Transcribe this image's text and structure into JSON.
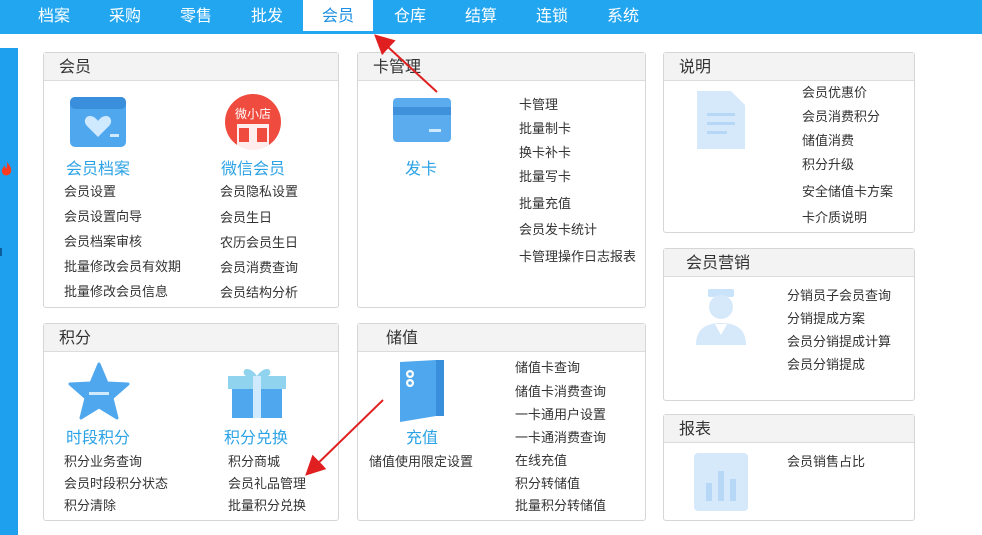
{
  "nav": [
    "档案",
    "采购",
    "零售",
    "批发",
    "会员",
    "仓库",
    "结算",
    "连锁",
    "系统"
  ],
  "active_nav": "会员",
  "member": {
    "title": "会员",
    "archive_label": "会员档案",
    "wechat_label": "微信会员",
    "wechat_badge": "微小店",
    "left_links": [
      "会员设置",
      "会员设置向导",
      "会员档案审核",
      "批量修改会员有效期",
      "批量修改会员信息"
    ],
    "right_links": [
      "会员隐私设置",
      "会员生日",
      "农历会员生日",
      "会员消费查询",
      "会员结构分析"
    ]
  },
  "card": {
    "title": "卡管理",
    "issue_label": "发卡",
    "links": [
      "卡管理",
      "批量制卡",
      "换卡补卡",
      "批量写卡",
      "批量充值",
      "会员发卡统计",
      "卡管理操作日志报表"
    ]
  },
  "notes": {
    "title": "说明",
    "links": [
      "会员优惠价",
      "会员消费积分",
      "储值消费",
      "积分升级",
      "安全储值卡方案",
      "卡介质说明"
    ]
  },
  "points": {
    "title": "积分",
    "period_label": "时段积分",
    "exchange_label": "积分兑换",
    "left_links": [
      "积分业务查询",
      "会员时段积分状态",
      "积分清除"
    ],
    "right_links": [
      "积分商城",
      "会员礼品管理",
      "批量积分兑换"
    ]
  },
  "stored": {
    "title": "储值",
    "recharge_label": "充值",
    "limit_link": "储值使用限定设置",
    "links": [
      "储值卡查询",
      "储值卡消费查询",
      "一卡通用户设置",
      "一卡通消费查询",
      "在线充值",
      "积分转储值",
      "批量积分转储值"
    ]
  },
  "marketing": {
    "title": "会员营销",
    "links": [
      "分销员子会员查询",
      "分销提成方案",
      "会员分销提成计算",
      "会员分销提成"
    ]
  },
  "report": {
    "title": "报表",
    "links": [
      "会员销售占比"
    ]
  },
  "colors": {
    "nav_bg": "#23a6f0",
    "accent": "#2ca3e6",
    "annotation_arrow": "#e02020"
  }
}
